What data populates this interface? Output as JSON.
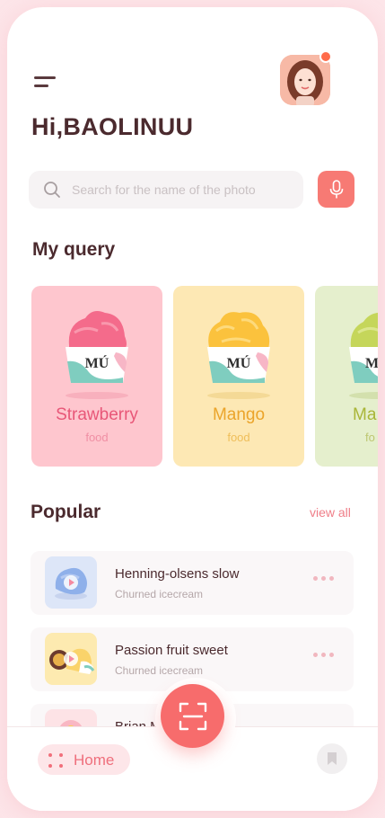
{
  "header": {
    "greeting": "Hi,BAOLINUU"
  },
  "search": {
    "placeholder": "Search for the name of the photo"
  },
  "my_query": {
    "title": "My query",
    "cards": [
      {
        "name": "Strawberry",
        "type": "food",
        "brand": "MÚ"
      },
      {
        "name": "Mango",
        "type": "food",
        "brand": "MÚ"
      },
      {
        "name": "Ma",
        "type": "fo",
        "brand": "M"
      }
    ]
  },
  "popular": {
    "title": "Popular",
    "view_all": "view all",
    "items": [
      {
        "name": "Henning-olsens slow",
        "subtitle": "Churned icecream"
      },
      {
        "name": "Passion fruit sweet",
        "subtitle": "Churned icecream"
      },
      {
        "name": "Brian Mo",
        "subtitle": ""
      }
    ]
  },
  "nav": {
    "home_label": "Home"
  },
  "colors": {
    "accent": "#f77a74",
    "title": "#4b2a2e",
    "strawberry": "#fec6ce",
    "mango": "#fde8b4",
    "matcha": "#e5efcd"
  },
  "icons": [
    "menu-icon",
    "search-icon",
    "microphone-icon",
    "scan-icon",
    "grid-dots-icon",
    "bookmark-icon",
    "play-icon"
  ]
}
